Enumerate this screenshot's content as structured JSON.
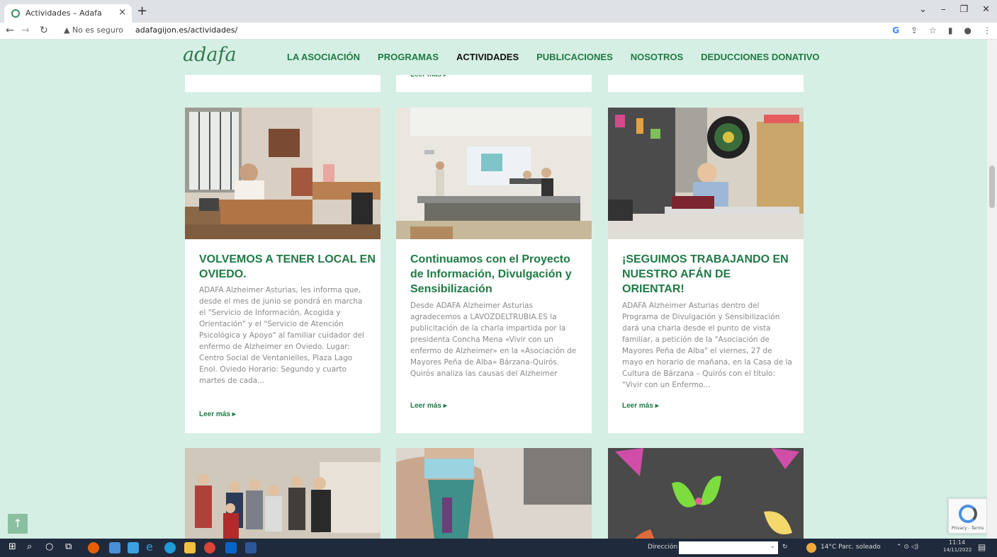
{
  "browser": {
    "tab_title": "Actividades – Adafa",
    "tab_close": "×",
    "new_tab": "+",
    "not_secure": "▲ No es seguro",
    "url": "adafagijon.es/actividades/",
    "window_controls": [
      "⌄",
      "–",
      "❐",
      "✕"
    ]
  },
  "site": {
    "logo": "adafa",
    "nav": [
      {
        "label": "LA ASOCIACIÓN"
      },
      {
        "label": "PROGRAMAS"
      },
      {
        "label": "ACTIVIDADES"
      },
      {
        "label": "PUBLICACIONES"
      },
      {
        "label": "NOSOTROS"
      },
      {
        "label": "DEDUCCIONES DONATIVO"
      }
    ],
    "active_nav": "ACTIVIDADES",
    "top_card_more": "Leer más ▸",
    "cards": [
      {
        "title": "VOLVEMOS A TENER LOCAL EN OVIEDO.",
        "excerpt": "ADAFA Alzheimer Asturias, les informa que, desde el mes de junio se pondrá en marcha el \"Servicio de Información, Acogida y Orientación\" y el \"Servicio de Atención Psicológica y Apoyo\" al familiar cuidador del enfermo de Alzheimer en Oviedo. Lugar: Centro Social de Ventanielles, Plaza Lago Enol. Oviedo Horario: Segundo y cuarto martes de cada...",
        "more": "Leer más ▸"
      },
      {
        "title": "Continuamos con el Proyecto de Información, Divulgación y Sensibilización",
        "excerpt": "Desde ADAFA Alzheimer Asturias agradecemos a LAVOZDELTRUBIA.ES la publicitación de la charla impartida por la presidenta Concha Mena «Vivir con un enfermo de Alzheimer» en la «Asociación de Mayores Peña de Alba» Bárzana-Quirós.    Quirós analiza las causas del Alzheimer",
        "more": "Leer más ▸"
      },
      {
        "title": "¡SEGUIMOS TRABAJANDO EN NUESTRO AFÁN DE ORIENTAR!",
        "excerpt": "ADAFA Alzheimer Asturias dentro del Programa de Divulgación y Sensibilización dará una charla desde el punto de vista familiar, a petición de la \"Asociación de Mayores Peña de Alba\" el viernes, 27 de mayo en horario de mañana, en la Casa de la Cultura de Bárzana – Quirós con el título: \"Vivir con un Enfermo...",
        "more": "Leer más ▸"
      }
    ],
    "back_to_top": "↑",
    "recaptcha_text": "Privacy - Terms"
  },
  "taskbar": {
    "address_label": "Dirección",
    "weather": "14°C  Parc. soleado",
    "time": "11:14",
    "date": "14/11/2022"
  },
  "colors": {
    "page_bg": "#d6efe4",
    "brand_green": "#1f7a45",
    "taskbar": "#1f2a3c"
  }
}
